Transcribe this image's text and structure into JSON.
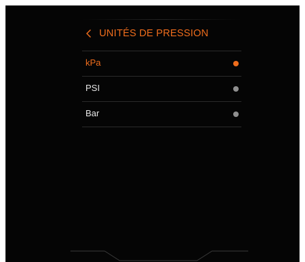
{
  "header": {
    "back_icon": "chevron-left-icon",
    "title": "UNITÉS DE PRESSION"
  },
  "units": [
    {
      "label": "kPa",
      "selected": true
    },
    {
      "label": "PSI",
      "selected": false
    },
    {
      "label": "Bar",
      "selected": false
    }
  ],
  "colors": {
    "accent": "#ef6d1c",
    "background": "#050505",
    "text": "#e8e8e8",
    "radio_inactive": "#8f8f8f",
    "divider": "#2a2a2a"
  }
}
